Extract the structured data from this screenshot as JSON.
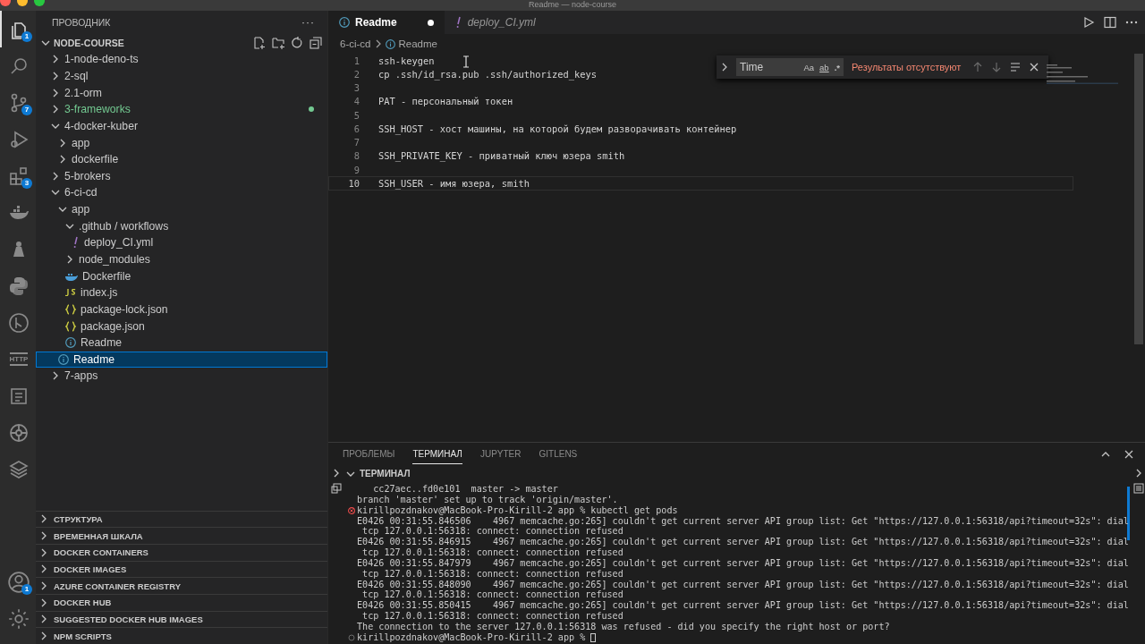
{
  "window": {
    "title": "Readme — node-course"
  },
  "activity_bar": {
    "items": [
      {
        "kind": "files",
        "badge": "1",
        "selected": true
      },
      {
        "kind": "search",
        "selected": false
      },
      {
        "kind": "branch",
        "badge": "7",
        "selected": false
      },
      {
        "kind": "debug",
        "selected": false
      },
      {
        "kind": "extensions",
        "badge": "3",
        "selected": false
      },
      {
        "kind": "whale",
        "selected": false
      },
      {
        "kind": "helm",
        "selected": false
      },
      {
        "kind": "python",
        "selected": false
      },
      {
        "kind": "gitlens",
        "selected": false
      },
      {
        "kind": "http",
        "label": "HTTP",
        "selected": false
      },
      {
        "kind": "notes",
        "selected": false
      },
      {
        "kind": "wheel",
        "selected": false
      },
      {
        "kind": "layers",
        "selected": false
      }
    ],
    "bottom": [
      {
        "kind": "account",
        "badge": "1"
      },
      {
        "kind": "gear"
      }
    ]
  },
  "sidebar": {
    "title": "ПРОВОДНИК",
    "more": "···",
    "workspace": {
      "label": "NODE-COURSE",
      "expanded": true,
      "items": [
        {
          "label": "1-node-deno-ts",
          "kind": "folder",
          "expanded": false,
          "selected": false
        },
        {
          "label": "2-sql",
          "kind": "folder",
          "expanded": false,
          "selected": false
        },
        {
          "label": "2.1-orm",
          "kind": "folder",
          "expanded": false,
          "selected": false
        },
        {
          "label": "3-frameworks",
          "kind": "folder",
          "expanded": false,
          "selected": false,
          "changed": true
        },
        {
          "label": "4-docker-kuber",
          "kind": "folder",
          "expanded": true,
          "selected": false,
          "children": [
            {
              "label": "app",
              "kind": "folder",
              "expanded": false,
              "selected": false
            },
            {
              "label": "dockerfile",
              "kind": "folder",
              "expanded": false,
              "selected": false
            }
          ]
        },
        {
          "label": "5-brokers",
          "kind": "folder",
          "expanded": false,
          "selected": false
        },
        {
          "label": "6-ci-cd",
          "kind": "folder",
          "expanded": true,
          "selected": false,
          "children": [
            {
              "label": "app",
              "kind": "folder",
              "expanded": true,
              "selected": false,
              "children": [
                {
                  "label": ".github / workflows",
                  "kind": "folder",
                  "expanded": true,
                  "selected": false,
                  "children": [
                    {
                      "label": "deploy_CI.yml",
                      "kind": "yaml",
                      "selected": false
                    }
                  ]
                },
                {
                  "label": "node_modules",
                  "kind": "folder",
                  "expanded": false,
                  "selected": false
                },
                {
                  "label": "Dockerfile",
                  "kind": "docker",
                  "selected": false
                },
                {
                  "label": "index.js",
                  "kind": "js",
                  "selected": false
                },
                {
                  "label": "package-lock.json",
                  "kind": "json",
                  "selected": false
                },
                {
                  "label": "package.json",
                  "kind": "json",
                  "selected": false
                },
                {
                  "label": "Readme",
                  "kind": "info",
                  "selected": false
                }
              ]
            },
            {
              "label": "Readme",
              "kind": "info",
              "selected": true
            }
          ]
        },
        {
          "label": "7-apps",
          "kind": "folder",
          "expanded": false,
          "selected": false
        }
      ]
    },
    "sections": [
      {
        "label": "СТРУКТУРА",
        "expanded": false
      },
      {
        "label": "ВРЕМЕННАЯ ШКАЛА",
        "expanded": false
      },
      {
        "label": "DOCKER CONTAINERS",
        "expanded": false
      },
      {
        "label": "DOCKER IMAGES",
        "expanded": false
      },
      {
        "label": "AZURE CONTAINER REGISTRY",
        "expanded": false
      },
      {
        "label": "DOCKER HUB",
        "expanded": false
      },
      {
        "label": "SUGGESTED DOCKER HUB IMAGES",
        "expanded": false
      },
      {
        "label": "NPM SCRIPTS",
        "expanded": false
      }
    ]
  },
  "editor": {
    "tabs": [
      {
        "label": "Readme",
        "kind": "info",
        "selected": true,
        "dirty": true,
        "preview": false
      },
      {
        "label": "deploy_CI.yml",
        "kind": "yaml",
        "selected": false,
        "dirty": false,
        "preview": true
      }
    ],
    "breadcrumb": [
      "6-ci-cd",
      "Readme"
    ],
    "lines": [
      {
        "n": "1",
        "text": "ssh-keygen"
      },
      {
        "n": "2",
        "text": "cp .ssh/id_rsa.pub .ssh/authorized_keys"
      },
      {
        "n": "3"
      },
      {
        "n": "4",
        "text": "PAT - персональный токен"
      },
      {
        "n": "5"
      },
      {
        "n": "6",
        "text": "SSH_HOST - хост машины, на которой будем разворачивать контейнер"
      },
      {
        "n": "7"
      },
      {
        "n": "8",
        "text": "SSH_PRIVATE_KEY - приватный ключ юзера smith"
      },
      {
        "n": "9"
      },
      {
        "n": "10",
        "text": "SSH_USER - имя юзера, smith",
        "current": true
      }
    ],
    "find": {
      "value": "Time",
      "options": [
        "Aa",
        "ab",
        ".*"
      ],
      "result": "Результаты отсутствуют"
    }
  },
  "panel": {
    "tabs": [
      {
        "label": "ПРОБЛЕМЫ",
        "selected": false
      },
      {
        "label": "ТЕРМИНАЛ",
        "selected": true
      },
      {
        "label": "JUPYTER",
        "selected": false
      },
      {
        "label": "GITLENS",
        "selected": false
      }
    ],
    "terminal_title": "ТЕРМИНАЛ",
    "lines": [
      {
        "kind": "plain",
        "text": "   cc27aec..fd0e101  master -> master"
      },
      {
        "kind": "plain",
        "text": "branch 'master' set up to track 'origin/master'."
      },
      {
        "kind": "failed",
        "text": "kirillpozdnakov@MacBook-Pro-Kirill-2 app % kubectl get pods"
      },
      {
        "kind": "plain",
        "text": "E0426 00:31:55.846506    4967 memcache.go:265] couldn't get current server API group list: Get \"https://127.0.0.1:56318/api?timeout=32s\": dial"
      },
      {
        "kind": "plain",
        "text": " tcp 127.0.0.1:56318: connect: connection refused"
      },
      {
        "kind": "plain",
        "text": "E0426 00:31:55.846915    4967 memcache.go:265] couldn't get current server API group list: Get \"https://127.0.0.1:56318/api?timeout=32s\": dial"
      },
      {
        "kind": "plain",
        "text": " tcp 127.0.0.1:56318: connect: connection refused"
      },
      {
        "kind": "plain",
        "text": "E0426 00:31:55.847979    4967 memcache.go:265] couldn't get current server API group list: Get \"https://127.0.0.1:56318/api?timeout=32s\": dial"
      },
      {
        "kind": "plain",
        "text": " tcp 127.0.0.1:56318: connect: connection refused"
      },
      {
        "kind": "plain",
        "text": "E0426 00:31:55.848090    4967 memcache.go:265] couldn't get current server API group list: Get \"https://127.0.0.1:56318/api?timeout=32s\": dial"
      },
      {
        "kind": "plain",
        "text": " tcp 127.0.0.1:56318: connect: connection refused"
      },
      {
        "kind": "plain",
        "text": "E0426 00:31:55.850415    4967 memcache.go:265] couldn't get current server API group list: Get \"https://127.0.0.1:56318/api?timeout=32s\": dial"
      },
      {
        "kind": "plain",
        "text": " tcp 127.0.0.1:56318: connect: connection refused"
      },
      {
        "kind": "plain",
        "text": "The connection to the server 127.0.0.1:56318 was refused - did you specify the right host or port?"
      },
      {
        "kind": "prompt",
        "text": "kirillpozdnakov@MacBook-Pro-Kirill-2 app % ",
        "cursor": true
      }
    ]
  }
}
